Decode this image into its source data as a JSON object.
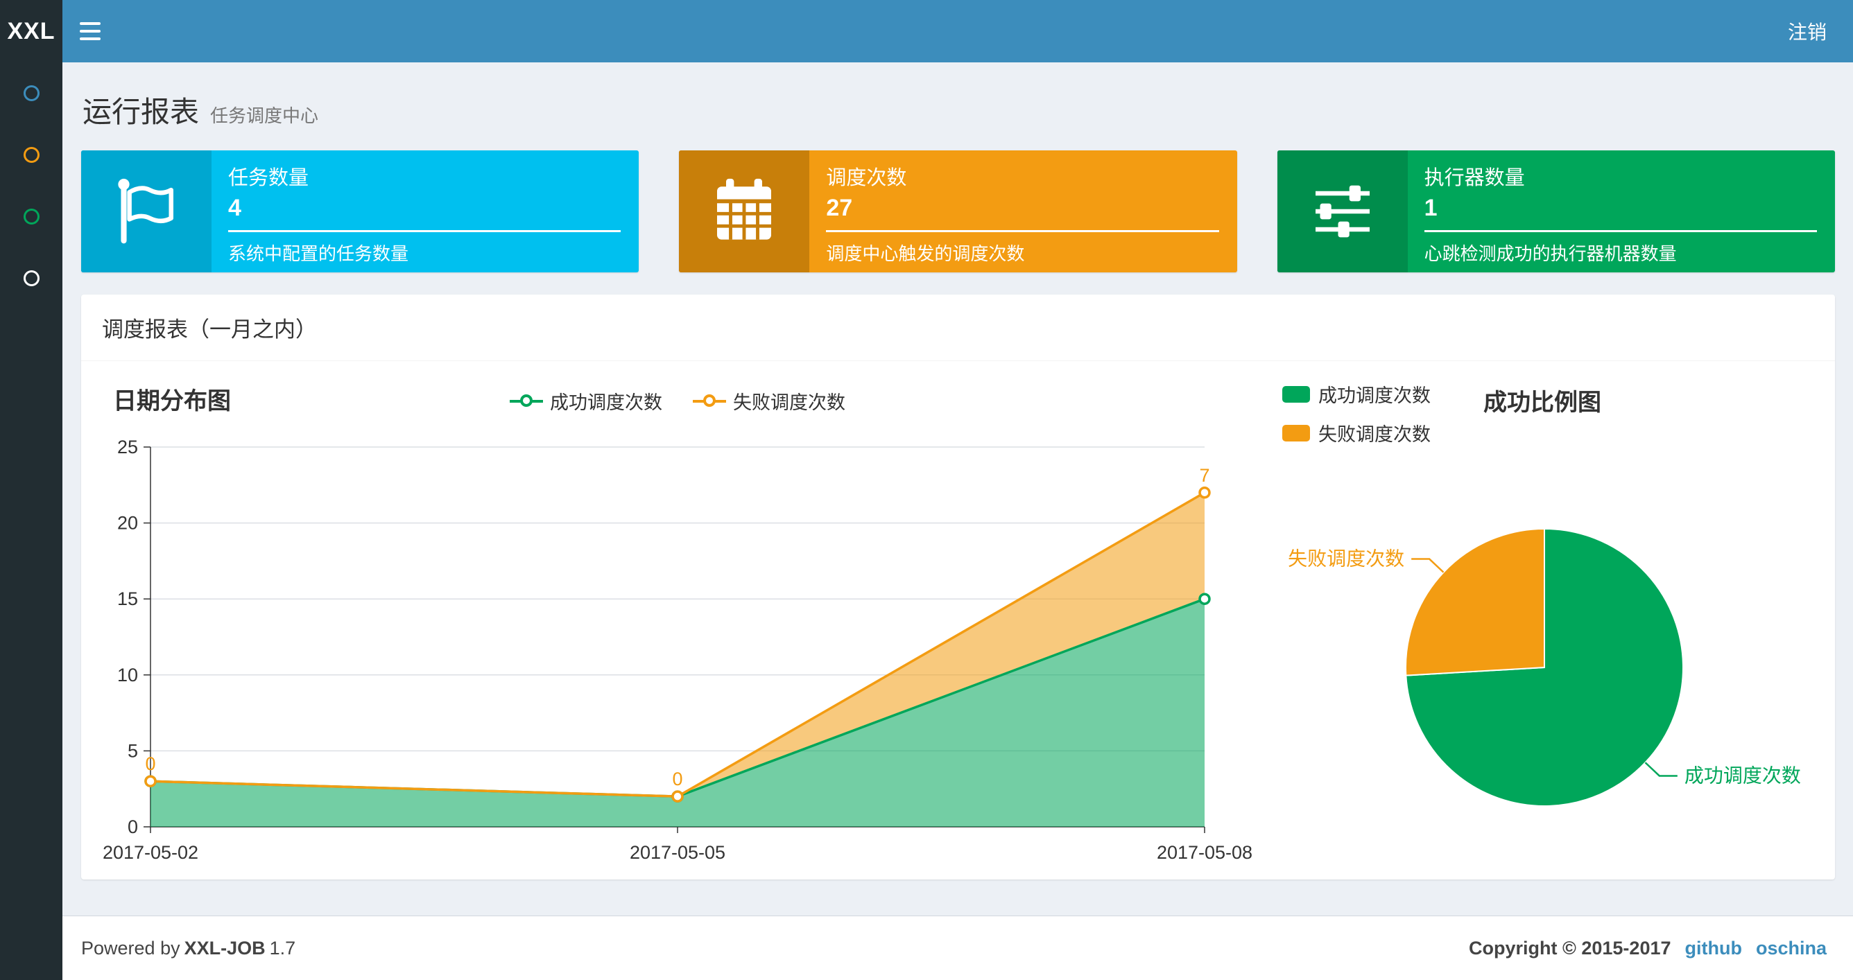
{
  "theme": {
    "navbar_bg": "#3c8dbc",
    "sidebar_bg": "#222d32",
    "content_bg": "#ecf0f5",
    "link_color": "#3c8dbc"
  },
  "header": {
    "logo_text": "XXL",
    "menu_icon": "hamburger-icon",
    "logout_label": "注销"
  },
  "sidebar": {
    "items": [
      {
        "icon": "circle-icon",
        "color": "#3c8dbc"
      },
      {
        "icon": "circle-icon",
        "color": "#f39c12"
      },
      {
        "icon": "circle-icon",
        "color": "#00a65a"
      },
      {
        "icon": "circle-icon",
        "color": "#ffffff"
      }
    ]
  },
  "page": {
    "title": "运行报表",
    "subtitle": "任务调度中心"
  },
  "info_boxes": [
    {
      "icon": "flag-icon",
      "label": "任务数量",
      "value": "4",
      "desc": "系统中配置的任务数量",
      "bg": "#00c0ef",
      "icon_bg": "#00a7d0"
    },
    {
      "icon": "calendar-icon",
      "label": "调度次数",
      "value": "27",
      "desc": "调度中心触发的调度次数",
      "bg": "#f39c12",
      "icon_bg": "#c87f0a"
    },
    {
      "icon": "sliders-icon",
      "label": "执行器数量",
      "value": "1",
      "desc": "心跳检测成功的执行器机器数量",
      "bg": "#00a65a",
      "icon_bg": "#008d4c"
    }
  ],
  "panel": {
    "title": "调度报表（一月之内）"
  },
  "chart_data": [
    {
      "type": "area",
      "title": "日期分布图",
      "stacked": true,
      "grid": true,
      "legend_position": "top",
      "x": [
        "2017-05-02",
        "2017-05-05",
        "2017-05-08"
      ],
      "series": [
        {
          "name": "成功调度次数",
          "color": "#00a65a",
          "values": [
            3,
            2,
            15
          ]
        },
        {
          "name": "失败调度次数",
          "color": "#f39c12",
          "values": [
            0,
            0,
            7
          ],
          "point_labels": [
            "0",
            "0",
            "7"
          ]
        }
      ],
      "ylim": [
        0,
        25
      ],
      "yticks": [
        0,
        5,
        10,
        15,
        20,
        25
      ]
    },
    {
      "type": "pie",
      "title": "成功比例图",
      "legend_position": "top-left",
      "slices": [
        {
          "name": "成功调度次数",
          "value": 20,
          "color": "#00a65a"
        },
        {
          "name": "失败调度次数",
          "value": 7,
          "color": "#f39c12"
        }
      ]
    }
  ],
  "footer": {
    "powered_prefix": "Powered by",
    "product": "XXL-JOB",
    "version": "1.7",
    "copyright": "Copyright © 2015-2017",
    "links": [
      "github",
      "oschina"
    ]
  }
}
